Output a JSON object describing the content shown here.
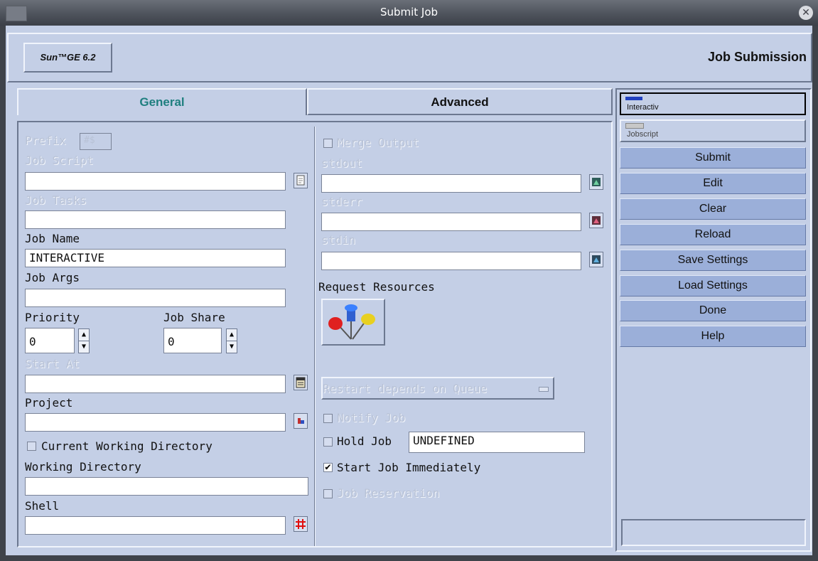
{
  "window": {
    "title": "Submit Job"
  },
  "header": {
    "logo": "Sun™GE 6.2",
    "heading": "Job Submission"
  },
  "tabs": {
    "general": "General",
    "advanced": "Advanced"
  },
  "general": {
    "prefix_label": "Prefix",
    "prefix_value": "#$",
    "job_script_label": "Job Script",
    "job_tasks_label": "Job Tasks",
    "job_name_label": "Job Name",
    "job_name_value": "INTERACTIVE",
    "job_args_label": "Job Args",
    "priority_label": "Priority",
    "priority_value": "0",
    "job_share_label": "Job Share",
    "job_share_value": "0",
    "start_at_label": "Start At",
    "project_label": "Project",
    "cwd_label": "Current Working Directory",
    "working_dir_label": "Working Directory",
    "shell_label": "Shell"
  },
  "output": {
    "merge_output_label": "Merge Output",
    "stdout_label": "stdout",
    "stderr_label": "stderr",
    "stdin_label": "stdin",
    "request_resources_label": "Request Resources",
    "restart_label": "Restart depends on Queue",
    "notify_label": "Notify Job",
    "hold_label": "Hold Job",
    "hold_value": "UNDEFINED",
    "start_immediately_label": "Start Job Immediately",
    "start_immediately_checked": true,
    "reservation_label": "Job Reservation"
  },
  "actions": {
    "mode_interactive": "Interactiv",
    "mode_jobscript": "Jobscript",
    "submit": "Submit",
    "edit": "Edit",
    "clear": "Clear",
    "reload": "Reload",
    "save_settings": "Save Settings",
    "load_settings": "Load Settings",
    "done": "Done",
    "help": "Help"
  },
  "colors": {
    "window_bg": "#c4cfe6",
    "button_bg": "#9bafd9",
    "tab_active_text": "#1f7f7f"
  }
}
